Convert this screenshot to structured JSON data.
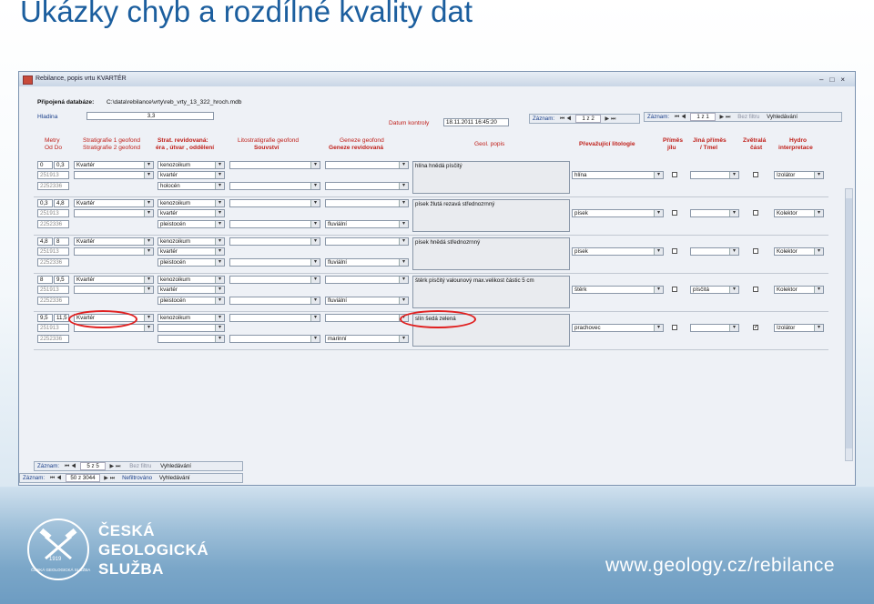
{
  "slide": {
    "title": "Ukázky chyb a rozdílné kvality dat",
    "org_line1": "ČESKÁ",
    "org_line2": "GEOLOGICKÁ",
    "org_line3": "SLUŽBA",
    "logo_year": "1919",
    "logo_ring": "ČESKÁ GEOLOGICKÁ SLUŽBA",
    "url": "www.geology.cz/rebilance"
  },
  "window": {
    "title": "Rebilance, popis vrtu  KVARTÉR",
    "db_label": "Připojená databáze:",
    "db_path": "C:\\data\\rebilance\\vrty\\reb_vrty_13_322_hroch.mdb",
    "hladina_label": "Hladina",
    "hladina_value": "3,3",
    "datum_label": "Datum kontroly",
    "datum_value": "18.11.2011 16:45:20",
    "top_nav1": {
      "label": "Záznam:",
      "value": "1 z 2"
    },
    "top_nav2": {
      "label": "Záznam:",
      "value": "1 z 1",
      "filter": "Bez filtru",
      "search": "Vyhledávání"
    },
    "headers": {
      "metry": "Metry",
      "oddo": "Od  Do",
      "strat1": "Stratigrafie 1 geofond",
      "strat2": "Stratigrafie 2 geofond",
      "strat_rev1": "Strat. revidovaná:",
      "strat_rev2": "éra , útvar , oddělení",
      "lito1": "Litostratigrafie geofond",
      "lito2": "Souvství",
      "gen1": "Geneze geofond",
      "gen2": "Geneze revidovaná",
      "geol": "Geol. popis",
      "prevaz": "Převažující litologie",
      "prim1": "Příměs",
      "prim2": "jílu",
      "jina1": "Jiná příměs",
      "jina2": "/ Tmel",
      "zvet1": "Zvětralá",
      "zvet2": "část",
      "hydro1": "Hydro",
      "hydro2": "interpretace"
    },
    "rows": [
      {
        "od": "0",
        "do": "0,3",
        "code1": "251913",
        "code2": "2252336",
        "strat": "Kvartér",
        "era": "kenozoikum",
        "utvar": "kvartér",
        "odd": "holocén",
        "geneze": "",
        "popis": "hlína hnědá   písčitý",
        "litologie": "hlína",
        "jina": "",
        "hydro": "Izolátor",
        "zvet": false
      },
      {
        "od": "0,3",
        "do": "4,8",
        "code1": "251913",
        "code2": "2252336",
        "strat": "Kvartér",
        "era": "kenozoikum",
        "utvar": "kvartér",
        "odd": "pleistocén",
        "geneze": "fluviální",
        "popis": "písek žlutá rezavá   střednozrnný",
        "litologie": "písek",
        "jina": "",
        "hydro": "Kolektor",
        "zvet": false
      },
      {
        "od": "4,8",
        "do": "8",
        "code1": "251913",
        "code2": "2252336",
        "strat": "Kvartér",
        "era": "kenozoikum",
        "utvar": "kvartér",
        "odd": "pleistocén",
        "geneze": "fluviální",
        "popis": "písek hnědá   střednozrnný",
        "litologie": "písek",
        "jina": "",
        "hydro": "Kolektor",
        "zvet": false
      },
      {
        "od": "8",
        "do": "9,5",
        "code1": "251913",
        "code2": "2252336",
        "strat": "Kvartér",
        "era": "kenozoikum",
        "utvar": "kvartér",
        "odd": "pleistocén",
        "geneze": "fluviální",
        "popis": "štěrk    písčitý valounový max.velikost částic 5 cm",
        "litologie": "štěrk",
        "jina": "písčitá",
        "hydro": "Kolektor",
        "zvet": false
      },
      {
        "od": "9,5",
        "do": "11,5",
        "code1": "251913",
        "code2": "2252336",
        "strat": "Kvartér",
        "era": "kenozoikum",
        "utvar": "",
        "odd": "",
        "geneze": "marinní",
        "popis": "slín šedá zelená",
        "litologie": "prachovec",
        "jina": "",
        "hydro": "Izolátor",
        "zvet": true
      }
    ],
    "bottom_nav1": {
      "label": "Záznam:",
      "value": "5 z 5",
      "filter": "Bez filtru",
      "search": "Vyhledávání"
    },
    "bottom_nav2": {
      "label": "Záznam:",
      "value": "50 z 3044",
      "filter": "Nefiltrováno",
      "search": "Vyhledávání"
    }
  },
  "colors": {
    "annotation": "#e02020",
    "title_blue": "#1b5e9e",
    "header_red": "#c0201a",
    "header_blue": "#1a3f8a"
  }
}
